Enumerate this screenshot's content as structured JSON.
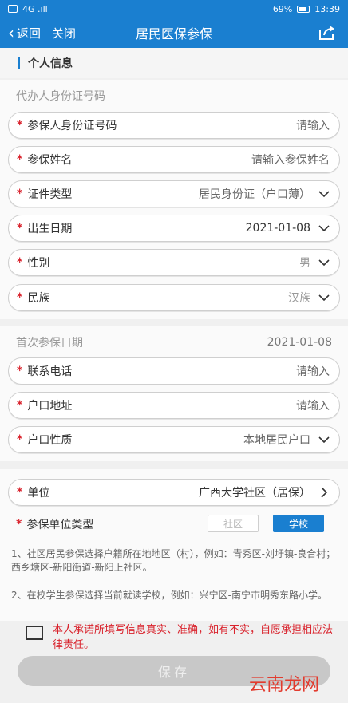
{
  "status_bar": {
    "left_text": "4G .ıll",
    "battery": "69%",
    "time": "13:39"
  },
  "nav": {
    "back": "返回",
    "close": "关闭",
    "title": "居民医保参保"
  },
  "section": {
    "title": "个人信息"
  },
  "agent_id": {
    "label": "代办人身份证号码"
  },
  "fields": {
    "insured_id": {
      "label": "参保人身份证号码",
      "value": "请输入"
    },
    "name": {
      "label": "参保姓名",
      "value": "请输入参保姓名"
    },
    "id_type": {
      "label": "证件类型",
      "value": "居民身份证（户口薄）"
    },
    "birth_date": {
      "label": "出生日期",
      "value": "2021-01-08"
    },
    "gender": {
      "label": "性别",
      "value": "男"
    },
    "ethnicity": {
      "label": "民族",
      "value": "汉族"
    },
    "first_date": {
      "label": "首次参保日期",
      "value": "2021-01-08"
    },
    "phone": {
      "label": "联系电话",
      "value": "请输入"
    },
    "household_address": {
      "label": "户口地址",
      "value": "请输入"
    },
    "household_type": {
      "label": "户口性质",
      "value": "本地居民户口"
    },
    "unit": {
      "label": "单位",
      "value": "广西大学社区（居保）"
    },
    "unit_type": {
      "label": "参保单位类型",
      "option_community": "社区",
      "option_school": "学校"
    }
  },
  "notes": {
    "note1": "1、社区居民参保选择户籍所在地地区（村），例如：青秀区-刘圩镇-良合村；西乡塘区-新阳街道-新阳上社区。",
    "note2": "2、在校学生参保选择当前就读学校，例如：兴宁区-南宁市明秀东路小学。"
  },
  "agreement": {
    "text": "本人承诺所填写信息真实、准确，如有不实，自愿承担相应法律责任。"
  },
  "save": {
    "label": "保存"
  },
  "watermark": {
    "text": "云南龙网"
  },
  "colors": {
    "primary": "#1a7fd0",
    "required": "#d9232d",
    "disabled": "#c8c8c8"
  }
}
